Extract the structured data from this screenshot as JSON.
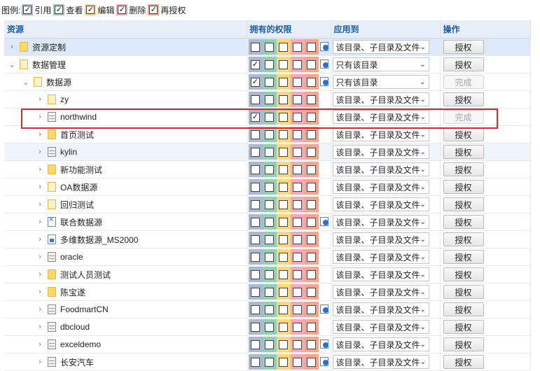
{
  "legend": {
    "title": "图例:",
    "items": [
      {
        "label": "引用",
        "cls": "c-read",
        "checked": true
      },
      {
        "label": "查看",
        "cls": "c-view",
        "checked": true
      },
      {
        "label": "编辑",
        "cls": "c-edit",
        "checked": true
      },
      {
        "label": "删除",
        "cls": "c-del",
        "checked": true
      },
      {
        "label": "再授权",
        "cls": "c-grant",
        "checked": true
      }
    ]
  },
  "columns": {
    "resource": "资源",
    "permissions": "拥有的权限",
    "apply_to": "应用到",
    "actions": "操作"
  },
  "rows": [
    {
      "name": "资源定制",
      "indent": 0,
      "arrow": "›",
      "icon": "folder",
      "perms": [
        false,
        false,
        false,
        false,
        false
      ],
      "inherit": true,
      "apply": "该目录、子目录及文件",
      "button": "授权",
      "btn_disabled": false,
      "state": "sel"
    },
    {
      "name": "数据管理",
      "indent": 0,
      "arrow": "⌄",
      "icon": "folder-open",
      "perms": [
        true,
        false,
        false,
        false,
        false
      ],
      "inherit": true,
      "apply": "只有该目录",
      "button": "授权",
      "btn_disabled": false,
      "state": ""
    },
    {
      "name": "数据源",
      "indent": 1,
      "arrow": "⌄",
      "icon": "folder-open",
      "perms": [
        true,
        false,
        false,
        false,
        false
      ],
      "inherit": true,
      "apply": "只有该目录",
      "button": "完成",
      "btn_disabled": true,
      "state": ""
    },
    {
      "name": "zy",
      "indent": 2,
      "arrow": "›",
      "icon": "folder-open",
      "perms": [
        false,
        false,
        false,
        false,
        false
      ],
      "inherit": false,
      "apply": "该目录、子目录及文件",
      "button": "授权",
      "btn_disabled": false,
      "state": ""
    },
    {
      "name": "northwind",
      "indent": 2,
      "arrow": "›",
      "icon": "db",
      "perms": [
        true,
        false,
        false,
        false,
        false
      ],
      "inherit": false,
      "apply": "该目录、子目录及文件",
      "button": "完成",
      "btn_disabled": true,
      "state": ""
    },
    {
      "name": "首页测试",
      "indent": 2,
      "arrow": "›",
      "icon": "folder",
      "perms": [
        false,
        false,
        false,
        false,
        false
      ],
      "inherit": false,
      "apply": "该目录、子目录及文件",
      "button": "授权",
      "btn_disabled": false,
      "state": ""
    },
    {
      "name": "kylin",
      "indent": 2,
      "arrow": "›",
      "icon": "db",
      "perms": [
        false,
        false,
        false,
        false,
        false
      ],
      "inherit": false,
      "apply": "该目录、子目录及文件",
      "button": "授权",
      "btn_disabled": false,
      "state": "hover"
    },
    {
      "name": "新功能测试",
      "indent": 2,
      "arrow": "›",
      "icon": "folder",
      "perms": [
        false,
        false,
        false,
        false,
        false
      ],
      "inherit": false,
      "apply": "该目录、子目录及文件",
      "button": "授权",
      "btn_disabled": false,
      "state": ""
    },
    {
      "name": "OA数据源",
      "indent": 2,
      "arrow": "›",
      "icon": "folder-open",
      "perms": [
        false,
        false,
        false,
        false,
        false
      ],
      "inherit": false,
      "apply": "该目录、子目录及文件",
      "button": "授权",
      "btn_disabled": false,
      "state": ""
    },
    {
      "name": "回归测试",
      "indent": 2,
      "arrow": "›",
      "icon": "folder-open",
      "perms": [
        false,
        false,
        false,
        false,
        false
      ],
      "inherit": false,
      "apply": "该目录、子目录及文件",
      "button": "授权",
      "btn_disabled": false,
      "state": ""
    },
    {
      "name": "联合数据源",
      "indent": 2,
      "arrow": "›",
      "icon": "union",
      "perms": [
        false,
        false,
        false,
        false,
        false
      ],
      "inherit": true,
      "apply": "该目录、子目录及文件",
      "button": "授权",
      "btn_disabled": false,
      "state": ""
    },
    {
      "name": "多维数据源_MS2000",
      "indent": 2,
      "arrow": "›",
      "icon": "multi",
      "perms": [
        false,
        false,
        false,
        false,
        false
      ],
      "inherit": false,
      "apply": "该目录、子目录及文件",
      "button": "授权",
      "btn_disabled": false,
      "state": ""
    },
    {
      "name": "oracle",
      "indent": 2,
      "arrow": "›",
      "icon": "db",
      "perms": [
        false,
        false,
        false,
        false,
        false
      ],
      "inherit": false,
      "apply": "该目录、子目录及文件",
      "button": "授权",
      "btn_disabled": false,
      "state": ""
    },
    {
      "name": "测试人员测试",
      "indent": 2,
      "arrow": "›",
      "icon": "folder",
      "perms": [
        false,
        false,
        false,
        false,
        false
      ],
      "inherit": false,
      "apply": "该目录、子目录及文件",
      "button": "授权",
      "btn_disabled": false,
      "state": ""
    },
    {
      "name": "陈宝遂",
      "indent": 2,
      "arrow": "›",
      "icon": "folder",
      "perms": [
        false,
        false,
        false,
        false,
        false
      ],
      "inherit": false,
      "apply": "该目录、子目录及文件",
      "button": "授权",
      "btn_disabled": false,
      "state": ""
    },
    {
      "name": "FoodmartCN",
      "indent": 2,
      "arrow": "›",
      "icon": "db",
      "perms": [
        false,
        false,
        false,
        false,
        false
      ],
      "inherit": true,
      "apply": "该目录、子目录及文件",
      "button": "授权",
      "btn_disabled": false,
      "state": ""
    },
    {
      "name": "dbcloud",
      "indent": 2,
      "arrow": "›",
      "icon": "db",
      "perms": [
        false,
        false,
        false,
        false,
        false
      ],
      "inherit": false,
      "apply": "该目录、子目录及文件",
      "button": "授权",
      "btn_disabled": false,
      "state": ""
    },
    {
      "name": "exceldemo",
      "indent": 2,
      "arrow": "›",
      "icon": "db",
      "perms": [
        false,
        false,
        false,
        false,
        false
      ],
      "inherit": true,
      "apply": "该目录、子目录及文件",
      "button": "授权",
      "btn_disabled": false,
      "state": ""
    },
    {
      "name": "长安汽车",
      "indent": 2,
      "arrow": "›",
      "icon": "db",
      "perms": [
        false,
        false,
        false,
        false,
        false
      ],
      "inherit": true,
      "apply": "该目录、子目录及文件",
      "button": "授权",
      "btn_disabled": false,
      "state": ""
    }
  ]
}
